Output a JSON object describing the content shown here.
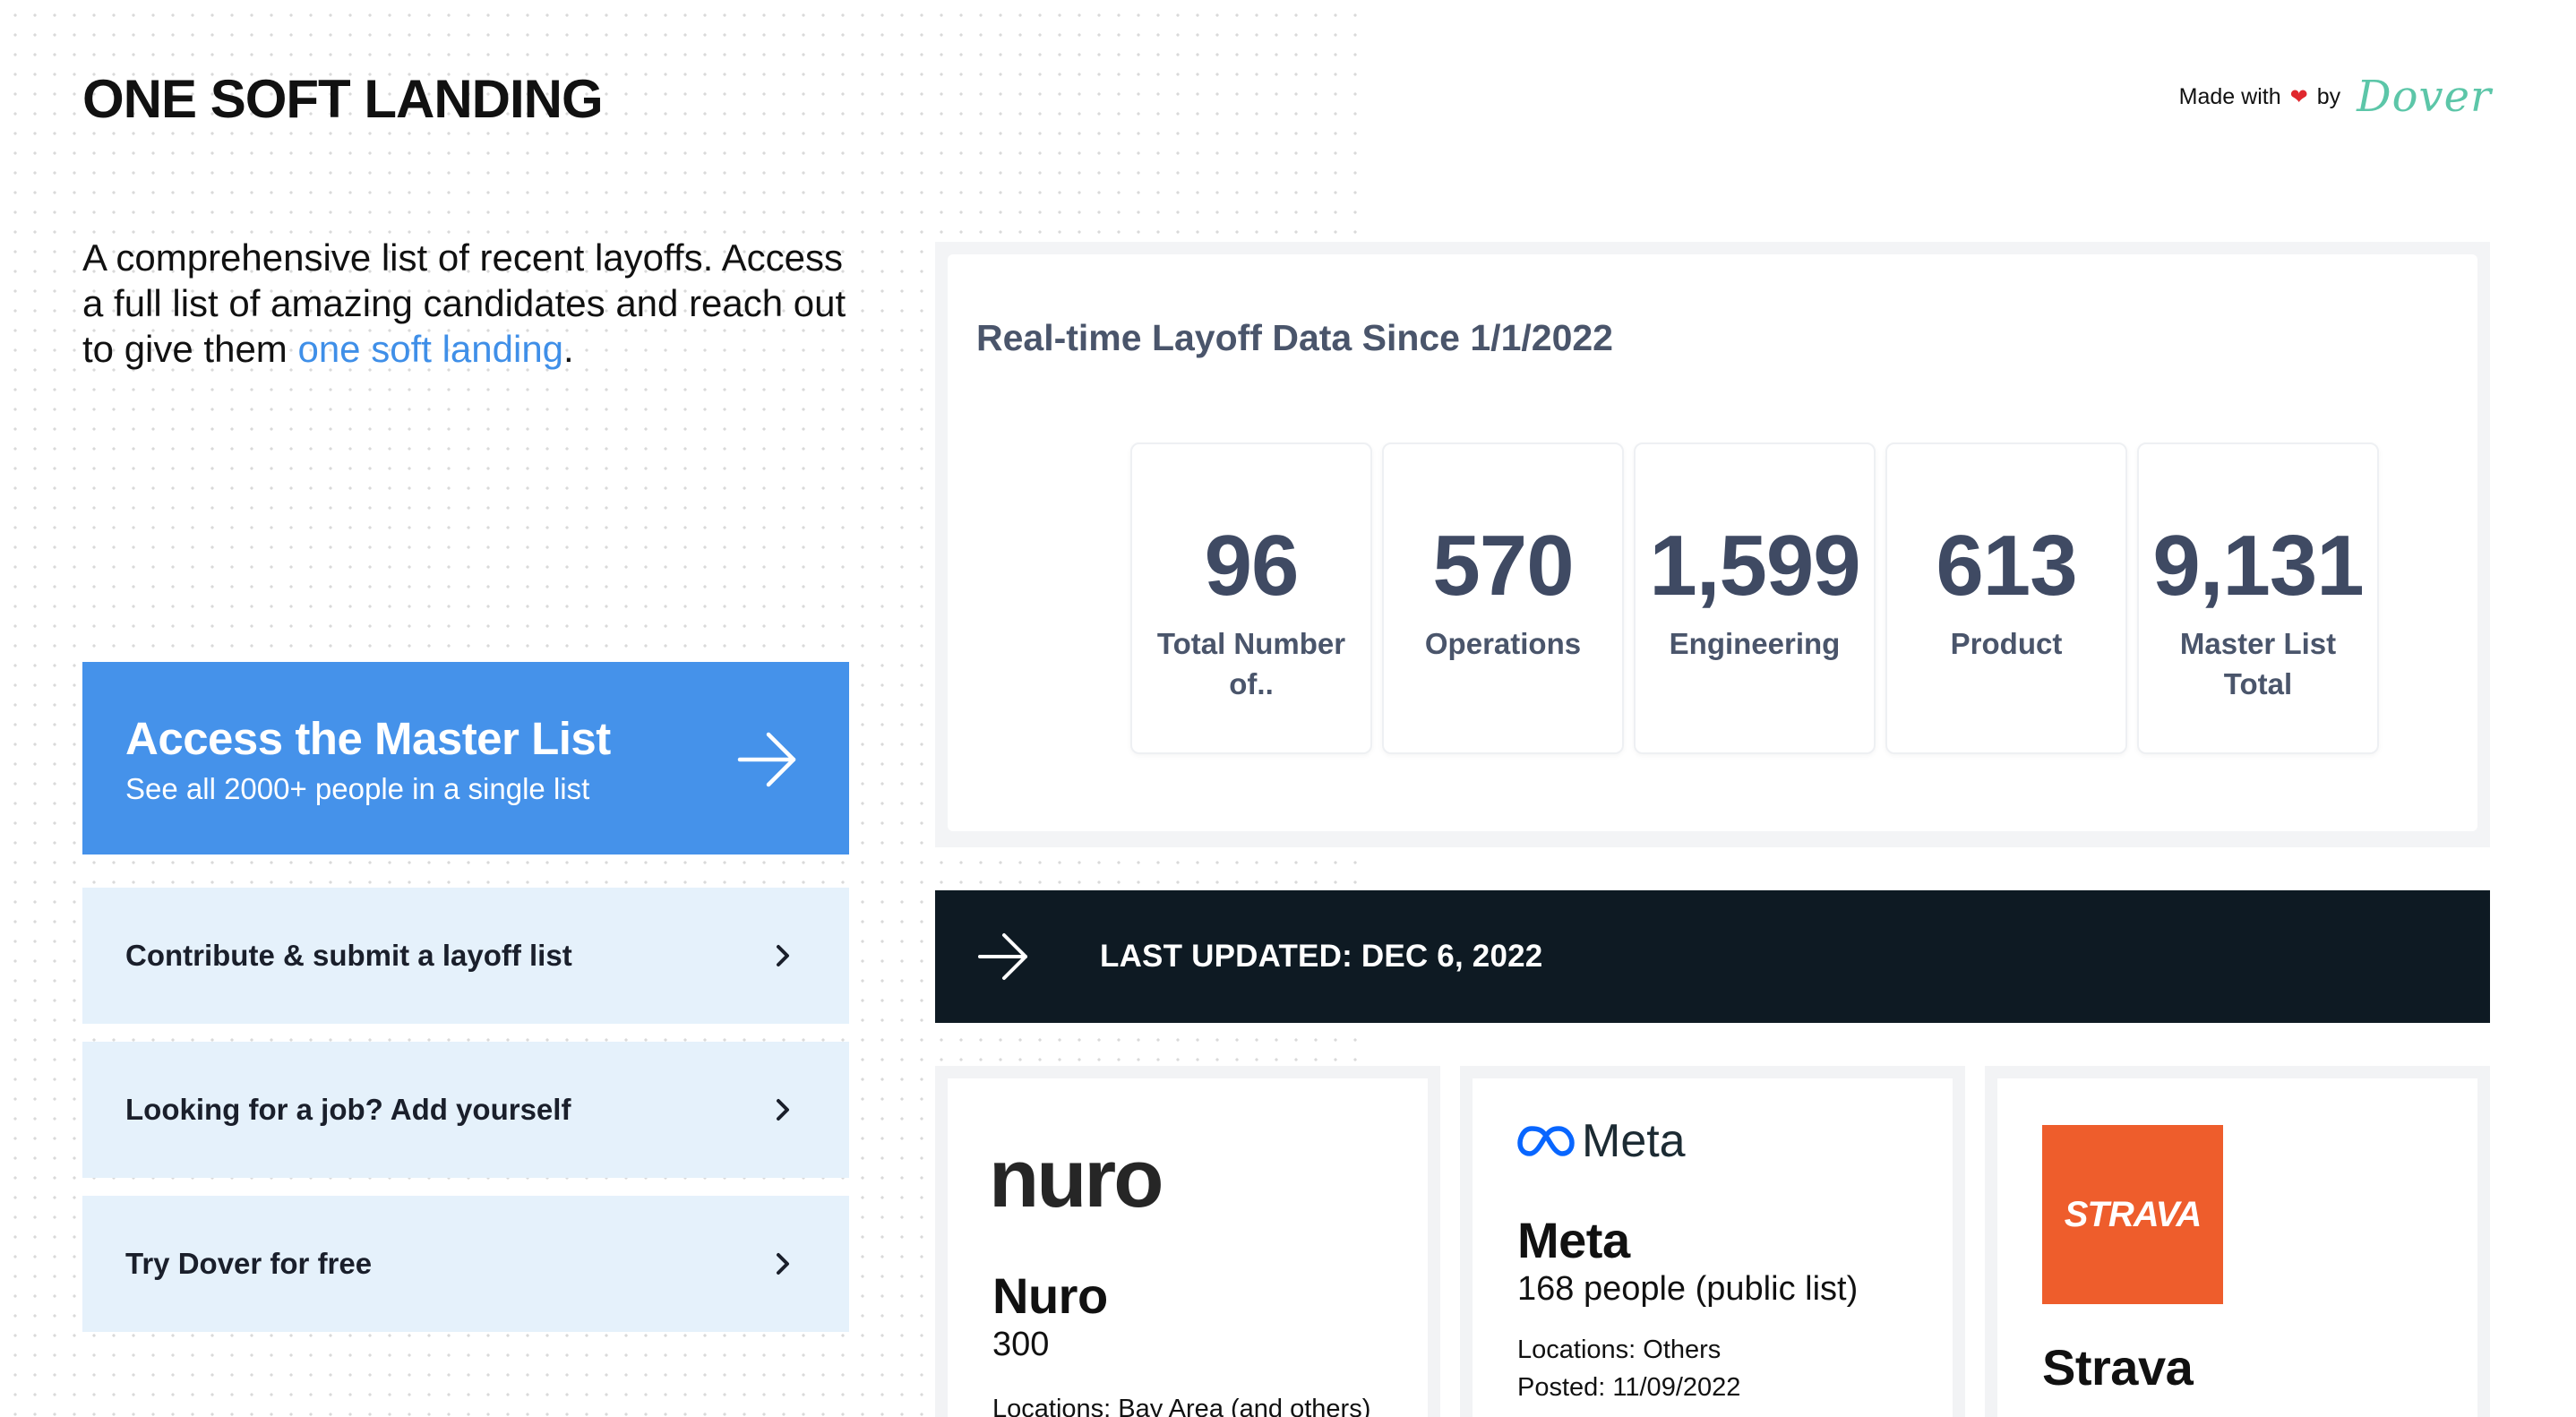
{
  "site": {
    "title": "ONE SOFT LANDING",
    "made_with": "Made with",
    "heart": "❤",
    "by": "by",
    "brand": "Dover"
  },
  "intro": {
    "text": "A comprehensive list of recent layoffs. Access a full list of amazing candidates and reach out to give them ",
    "link": "one soft landing",
    "end": "."
  },
  "master": {
    "title": "Access the Master List",
    "subtitle": "See all 2000+ people in a single list"
  },
  "links": [
    {
      "label": "Contribute & submit a layoff list"
    },
    {
      "label": "Looking for a job? Add yourself"
    },
    {
      "label": "Try Dover for free"
    }
  ],
  "stats": {
    "heading": "Real-time Layoff Data Since 1/1/2022",
    "tiles": [
      {
        "value": "96",
        "label": "Total Number of.."
      },
      {
        "value": "570",
        "label": "Operations"
      },
      {
        "value": "1,599",
        "label": "Engineering"
      },
      {
        "value": "613",
        "label": "Product"
      },
      {
        "value": "9,131",
        "label": "Master List Total"
      }
    ]
  },
  "updated": {
    "text": "LAST UPDATED: DEC 6, 2022"
  },
  "companies": [
    {
      "logo": "nuro",
      "name": "Nuro",
      "count": "300",
      "locations": "Locations: Bay Area (and others)"
    },
    {
      "logo": "Meta",
      "name": "Meta",
      "count": "168 people (public list)",
      "locations": "Locations: Others",
      "posted": "Posted: 11/09/2022"
    },
    {
      "logo": "STRAVA",
      "name": "Strava"
    }
  ],
  "colors": {
    "accent_blue": "#4592ea",
    "light_blue": "#e5f1fb",
    "dark_bar": "#0e1a23",
    "stat_text": "#3f4a63",
    "strava_orange": "#ee5d2c",
    "dover_green": "#5cc6a8"
  }
}
